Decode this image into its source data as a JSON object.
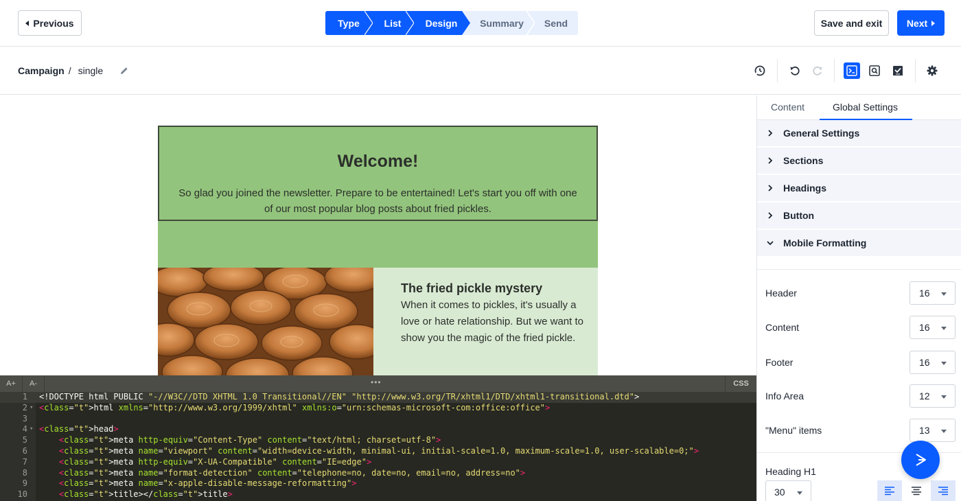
{
  "topbar": {
    "previous_label": "Previous",
    "save_exit_label": "Save and exit",
    "next_label": "Next",
    "steps": [
      {
        "label": "Type",
        "active": true
      },
      {
        "label": "List",
        "active": true
      },
      {
        "label": "Design",
        "active": true
      },
      {
        "label": "Summary",
        "active": false
      },
      {
        "label": "Send",
        "active": false
      }
    ]
  },
  "subbar": {
    "crumb_root": "Campaign",
    "crumb_sep": "/",
    "crumb_name": "single",
    "tools": [
      "history-icon",
      "undo-icon",
      "redo-icon",
      "code-view-icon",
      "preview-icon",
      "check-icon",
      "settings-icon"
    ]
  },
  "email": {
    "hero_title": "Welcome!",
    "hero_text": "So glad you joined the newsletter. Prepare to be entertained! Let's start you off with one of our most popular blog posts about fried pickles.",
    "post_title": "The fried pickle mystery",
    "post_text": "When it comes to pickles, it's usually a love or hate relationship. But we want to show you the magic of the fried pickle."
  },
  "editor": {
    "font_up": "A+",
    "font_down": "A-",
    "handle": "•••",
    "css_label": "CSS",
    "lines": [
      {
        "n": "1",
        "code": "<!DOCTYPE html PUBLIC \"-//W3C//DTD XHTML 1.0 Transitional//EN\" \"http://www.w3.org/TR/xhtml1/DTD/xhtml1-transitional.dtd\">"
      },
      {
        "n": "2",
        "code": "<html xmlns=\"http://www.w3.org/1999/xhtml\" xmlns:o=\"urn:schemas-microsoft-com:office:office\">"
      },
      {
        "n": "3",
        "code": ""
      },
      {
        "n": "4",
        "code": "<head>"
      },
      {
        "n": "5",
        "code": "    <meta http-equiv=\"Content-Type\" content=\"text/html; charset=utf-8\">"
      },
      {
        "n": "6",
        "code": "    <meta name=\"viewport\" content=\"width=device-width, minimal-ui, initial-scale=1.0, maximum-scale=1.0, user-scalable=0;\">"
      },
      {
        "n": "7",
        "code": "    <meta http-equiv=\"X-UA-Compatible\" content=\"IE=edge\">"
      },
      {
        "n": "8",
        "code": "    <meta name=\"format-detection\" content=\"telephone=no, date=no, email=no, address=no\">"
      },
      {
        "n": "9",
        "code": "    <meta name=\"x-apple-disable-message-reformatting\">"
      },
      {
        "n": "10",
        "code": "    <title></title>"
      }
    ]
  },
  "panel": {
    "tab_content": "Content",
    "tab_global": "Global Settings",
    "sections": [
      "General Settings",
      "Sections",
      "Headings",
      "Button",
      "Mobile Formatting"
    ],
    "rows": [
      {
        "label": "Header",
        "value": "16"
      },
      {
        "label": "Content",
        "value": "16"
      },
      {
        "label": "Footer",
        "value": "16"
      },
      {
        "label": "Info Area",
        "value": "12"
      },
      {
        "label": "\"Menu\" items",
        "value": "13"
      }
    ],
    "heading_label": "Heading H1",
    "heading_value": "30"
  },
  "colors": {
    "accent": "#0b5cff",
    "hero_green": "#93c47d",
    "post_green": "#d9ead3",
    "editor_bg": "#272822"
  }
}
